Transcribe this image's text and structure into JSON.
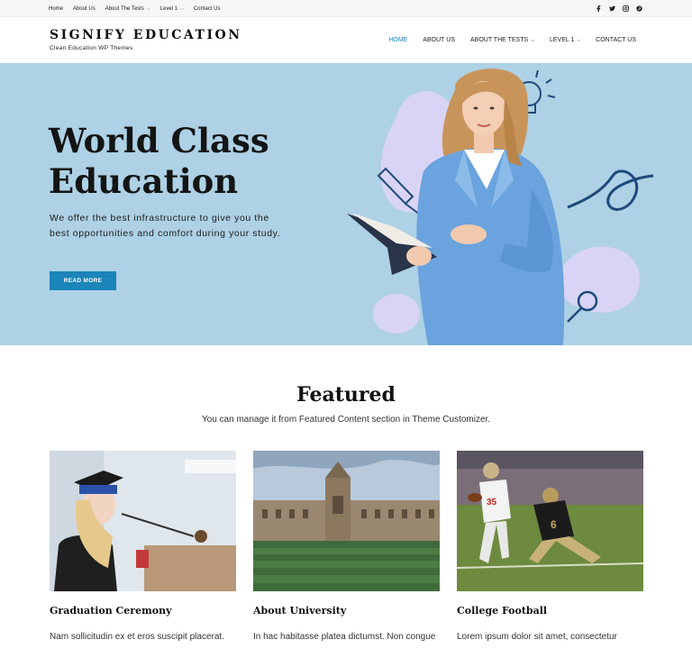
{
  "topbar": {
    "links": [
      {
        "label": "Home",
        "has_dropdown": false
      },
      {
        "label": "About Us",
        "has_dropdown": false
      },
      {
        "label": "About The Tests",
        "has_dropdown": true
      },
      {
        "label": "Level 1",
        "has_dropdown": true
      },
      {
        "label": "Contact Us",
        "has_dropdown": false
      }
    ],
    "social_icons": [
      "facebook-icon",
      "twitter-icon",
      "instagram-icon",
      "pinterest-icon"
    ]
  },
  "header": {
    "site_title": "SIGNIFY EDUCATION",
    "tagline": "Clean Education WP Themes",
    "nav": [
      {
        "label": "HOME",
        "active": true
      },
      {
        "label": "ABOUT US",
        "active": false
      },
      {
        "label": "ABOUT THE TESTS",
        "active": false,
        "has_dropdown": true
      },
      {
        "label": "LEVEL 1",
        "active": false,
        "has_dropdown": true
      },
      {
        "label": "CONTACT US",
        "active": false
      }
    ]
  },
  "hero": {
    "title_line1": "World Class",
    "title_line2": "Education",
    "text": "We offer the best infrastructure to give you the best opportunities and comfort during your study.",
    "button_label": "READ MORE"
  },
  "featured": {
    "title": "Featured",
    "subtitle": "You can manage it from Featured Content section in Theme Customizer.",
    "cards": [
      {
        "title": "Graduation Ceremony",
        "excerpt": "Nam sollicitudin ex et eros suscipit placerat."
      },
      {
        "title": "About University",
        "excerpt": "In hac habitasse platea dictumst. Non congue"
      },
      {
        "title": "College Football",
        "excerpt": "Lorem ipsum dolor sit amet, consectetur"
      }
    ]
  },
  "colors": {
    "accent": "#1b84b8",
    "hero_bg": "#aed1e5",
    "blob": "#d9d4f5",
    "doodle": "#1e4a7a"
  }
}
